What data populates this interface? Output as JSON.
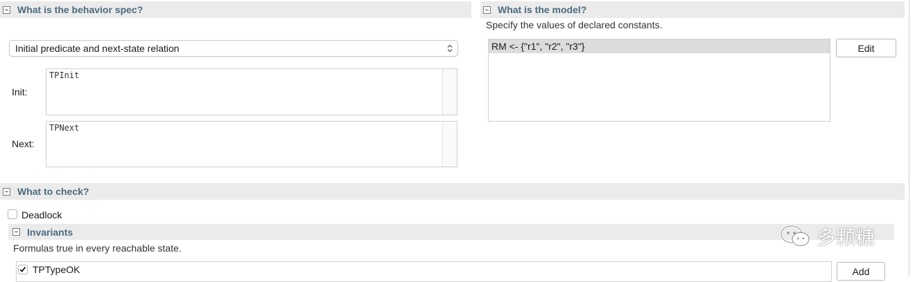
{
  "behavior": {
    "section_title": "What is the behavior spec?",
    "select_value": "Initial predicate and next-state relation",
    "init_label": "Init:",
    "init_value": "TPInit",
    "next_label": "Next:",
    "next_value": "TPNext"
  },
  "model": {
    "section_title": "What is the model?",
    "description": "Specify the values of declared constants.",
    "constants": [
      "RM <- {\"r1\", \"r2\", \"r3\"}"
    ],
    "edit_label": "Edit"
  },
  "check": {
    "section_title": "What to check?",
    "deadlock_label": "Deadlock",
    "deadlock_checked": false,
    "invariants": {
      "title": "Invariants",
      "description": "Formulas true in every reachable state.",
      "items": [
        {
          "label": "TPTypeOK",
          "checked": true
        }
      ],
      "add_label": "Add"
    }
  },
  "watermark": {
    "text": "多颗糖"
  }
}
